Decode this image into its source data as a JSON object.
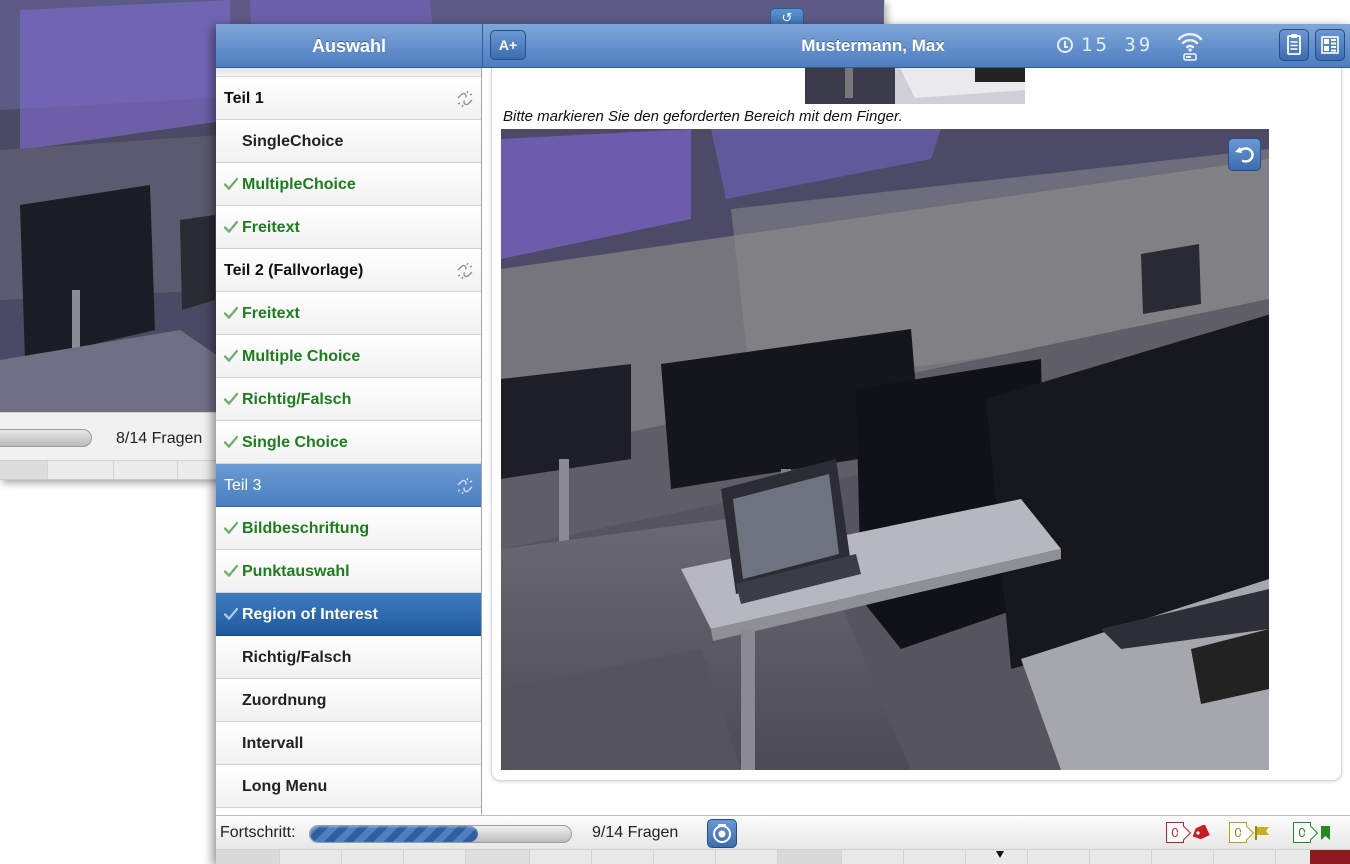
{
  "background_screen": {
    "progress_count": "8/14 Fragen",
    "sidebar_labels": [
      "Teil 1",
      "SingleChoice",
      "MultipleChoice",
      "Freitext",
      "Teil 2 (Fallvorlage)",
      "Freitext",
      "Multiple Choice",
      "Richtig/Falsch",
      "Single Choice"
    ]
  },
  "sidebar": {
    "title": "Auswahl",
    "items": [
      {
        "label": "Teil 1",
        "kind": "section",
        "status": "none"
      },
      {
        "label": "SingleChoice",
        "kind": "question",
        "status": "open"
      },
      {
        "label": "MultipleChoice",
        "kind": "question",
        "status": "answered"
      },
      {
        "label": "Freitext",
        "kind": "question",
        "status": "answered"
      },
      {
        "label": "Teil 2 (Fallvorlage)",
        "kind": "section",
        "status": "none"
      },
      {
        "label": "Freitext",
        "kind": "question",
        "status": "answered"
      },
      {
        "label": "Multiple Choice",
        "kind": "question",
        "status": "answered"
      },
      {
        "label": "Richtig/Falsch",
        "kind": "question",
        "status": "answered"
      },
      {
        "label": "Single Choice",
        "kind": "question",
        "status": "answered"
      },
      {
        "label": "Teil 3",
        "kind": "section",
        "status": "selected-section"
      },
      {
        "label": "Bildbeschriftung",
        "kind": "question",
        "status": "answered"
      },
      {
        "label": "Punktauswahl",
        "kind": "question",
        "status": "answered"
      },
      {
        "label": "Region of Interest",
        "kind": "question",
        "status": "current"
      },
      {
        "label": "Richtig/Falsch",
        "kind": "question",
        "status": "open"
      },
      {
        "label": "Zuordnung",
        "kind": "question",
        "status": "open"
      },
      {
        "label": "Intervall",
        "kind": "question",
        "status": "open"
      },
      {
        "label": "Long Menu",
        "kind": "question",
        "status": "open"
      }
    ]
  },
  "header": {
    "font_size_button": "A+",
    "candidate_name": "Mustermann, Max",
    "time": "15 39",
    "icons": [
      "clock-icon",
      "wifi-icon",
      "notes-icon",
      "overview-icon"
    ]
  },
  "question": {
    "instruction": "Bitte markieren Sie den geforderten Bereich mit dem Finger."
  },
  "footer": {
    "progress_label": "Fortschritt:",
    "progress_fraction": 0.643,
    "progress_count": "9/14 Fragen",
    "counters": {
      "tags": "0",
      "yellow_flags": "0",
      "green_flags": "0"
    }
  },
  "colors": {
    "accent_blue": "#4d7ec0",
    "answered_green": "#1e7d1e",
    "tag_red": "#c01f2a",
    "flag_yellow": "#b7a214"
  }
}
